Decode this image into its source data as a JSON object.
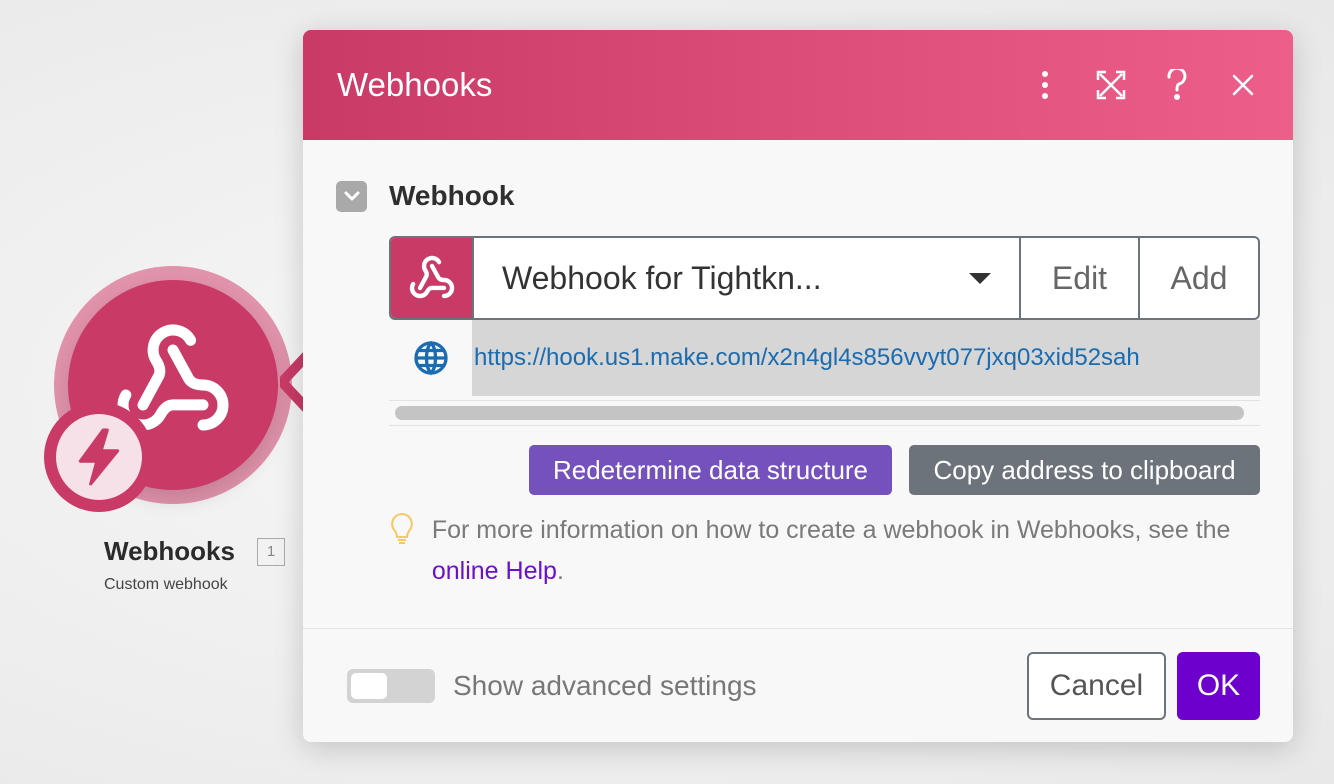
{
  "module": {
    "name": "Webhooks",
    "count": "1",
    "subtitle": "Custom webhook",
    "icon": "webhook-icon",
    "trigger_icon": "lightning-bolt-icon",
    "color": "#c93a66"
  },
  "dialog": {
    "title": "Webhooks",
    "header_icons": [
      "more-vertical-icon",
      "maximize-icon",
      "help-icon",
      "close-icon"
    ],
    "header_gradient": [
      "#c93a66",
      "#ed5e8a"
    ],
    "section": {
      "title": "Webhook",
      "collapsed": false
    },
    "webhook_select": {
      "value": "Webhook for Tightkn...",
      "edit_label": "Edit",
      "add_label": "Add"
    },
    "url": "https://hook.us1.make.com/x2n4gl4s856vvyt077jxq03xid52sah",
    "buttons": {
      "redetermine": "Redetermine data structure",
      "copy": "Copy address to clipboard"
    },
    "hint": {
      "text_before": "For more information on how to create a webhook in Webhooks, see the ",
      "link": "online Help",
      "text_after": "."
    },
    "footer": {
      "toggle_label": "Show advanced settings",
      "toggle_on": false,
      "cancel_label": "Cancel",
      "ok_label": "OK"
    },
    "colors": {
      "primary_button": "#6d00cc",
      "redetermine_button": "#7551bd",
      "copy_button": "#6c737b",
      "link": "#6a12c8",
      "url": "#1a6bb0"
    }
  }
}
